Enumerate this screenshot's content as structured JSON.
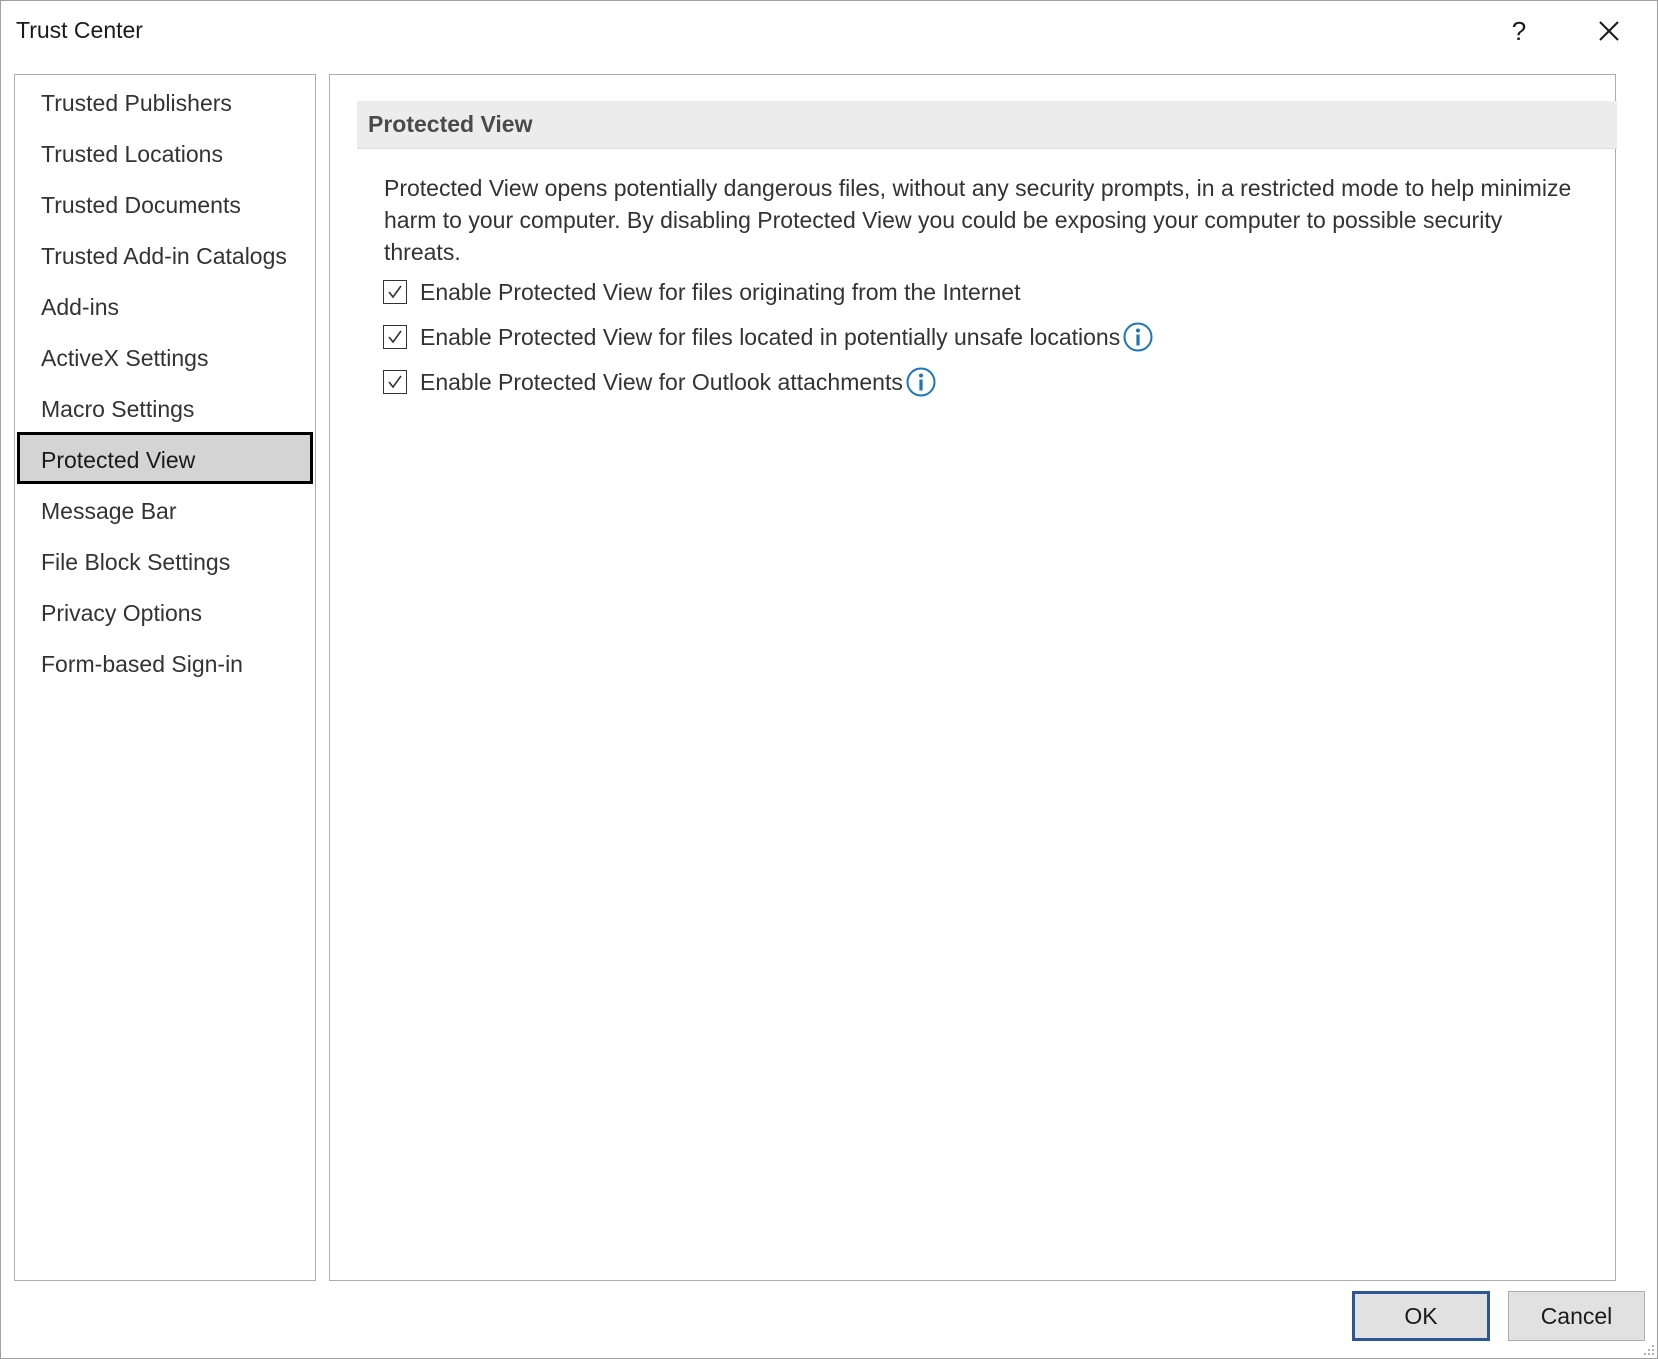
{
  "window": {
    "title": "Trust Center",
    "help_label": "?"
  },
  "sidebar": {
    "items": [
      {
        "label": "Trusted Publishers"
      },
      {
        "label": "Trusted Locations"
      },
      {
        "label": "Trusted Documents"
      },
      {
        "label": "Trusted Add-in Catalogs"
      },
      {
        "label": "Add-ins"
      },
      {
        "label": "ActiveX Settings"
      },
      {
        "label": "Macro Settings"
      },
      {
        "label": "Protected View"
      },
      {
        "label": "Message Bar"
      },
      {
        "label": "File Block Settings"
      },
      {
        "label": "Privacy Options"
      },
      {
        "label": "Form-based Sign-in"
      }
    ],
    "selected": "Protected View"
  },
  "main": {
    "section_title": "Protected View",
    "description": "Protected View opens potentially dangerous files, without any security prompts, in a restricted mode to help minimize harm to your computer. By disabling Protected View you could be exposing your computer to possible security threats.",
    "options": [
      {
        "label": "Enable Protected View for files originating from the Internet",
        "checked": true,
        "info": false
      },
      {
        "label": "Enable Protected View for files located in potentially unsafe locations",
        "checked": true,
        "info": true
      },
      {
        "label": "Enable Protected View for Outlook attachments",
        "checked": true,
        "info": true
      }
    ]
  },
  "footer": {
    "ok_label": "OK",
    "cancel_label": "Cancel"
  },
  "colors": {
    "accent_info": "#1b75bb",
    "ok_border": "#2b5797"
  },
  "icons": {
    "help": "question-mark",
    "close": "close-x",
    "checkbox": "checkmark",
    "info": "info-circle"
  }
}
